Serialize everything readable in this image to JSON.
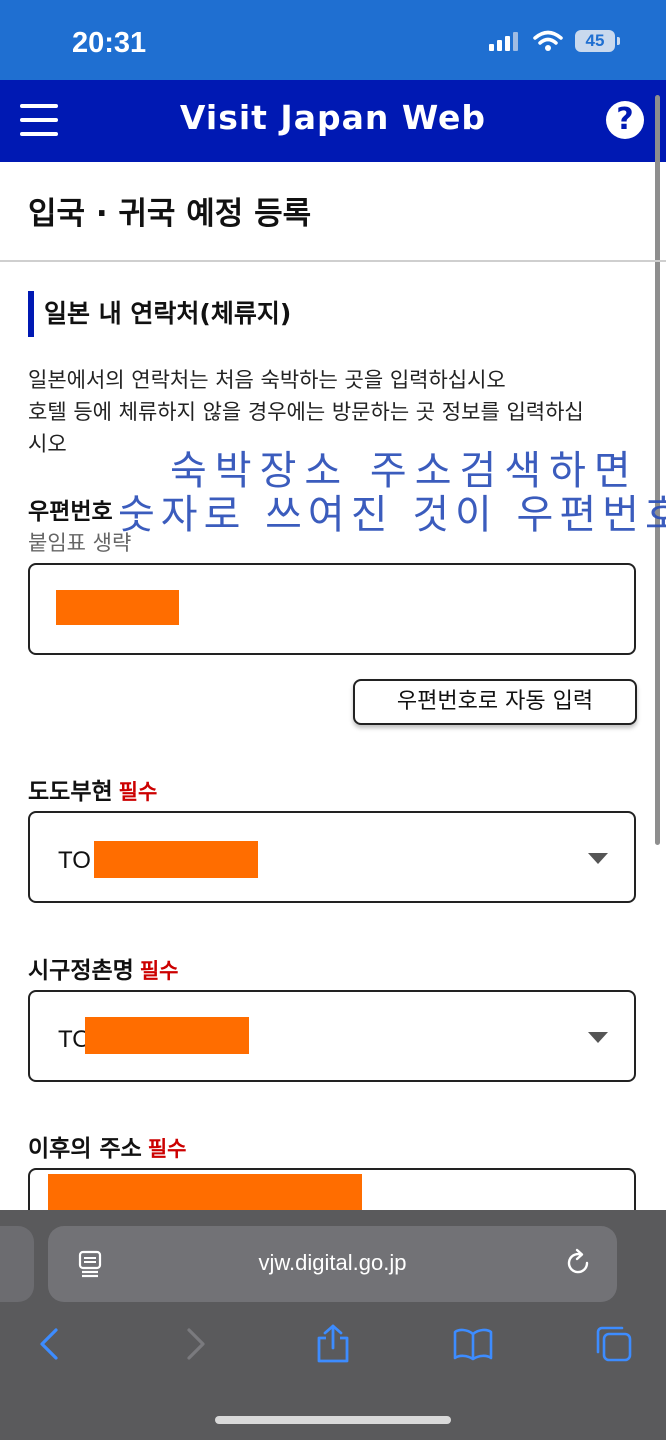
{
  "status": {
    "time": "20:31",
    "battery": "45"
  },
  "app": {
    "title": "Visit Japan Web"
  },
  "page": {
    "title": "입국 · 귀국 예정 등록"
  },
  "section": {
    "title": "일본 내 연락처(체류지)"
  },
  "description": {
    "line1": "일본에서의 연락처는 처음 숙박하는 곳을 입력하십시오",
    "line2": "호텔 등에 체류하지 않을 경우에는 방문하는 곳 정보를 입력하십",
    "line3": "시오"
  },
  "annotation": {
    "line1": "숙박장소 주소검색하면",
    "line2": "숫자로 쓰여진 것이 우편번호"
  },
  "postal": {
    "label": "우편번호",
    "hint": "붙임표 생략",
    "value": ""
  },
  "auto_fill": {
    "label": "우편번호로 자동 입력"
  },
  "prefecture": {
    "label": "도도부현",
    "required": "필수",
    "value": "TO"
  },
  "city": {
    "label": "시구정촌명",
    "required": "필수",
    "value": "TO"
  },
  "address": {
    "label": "이후의 주소",
    "required": "필수"
  },
  "browser": {
    "url": "vjw.digital.go.jp"
  }
}
